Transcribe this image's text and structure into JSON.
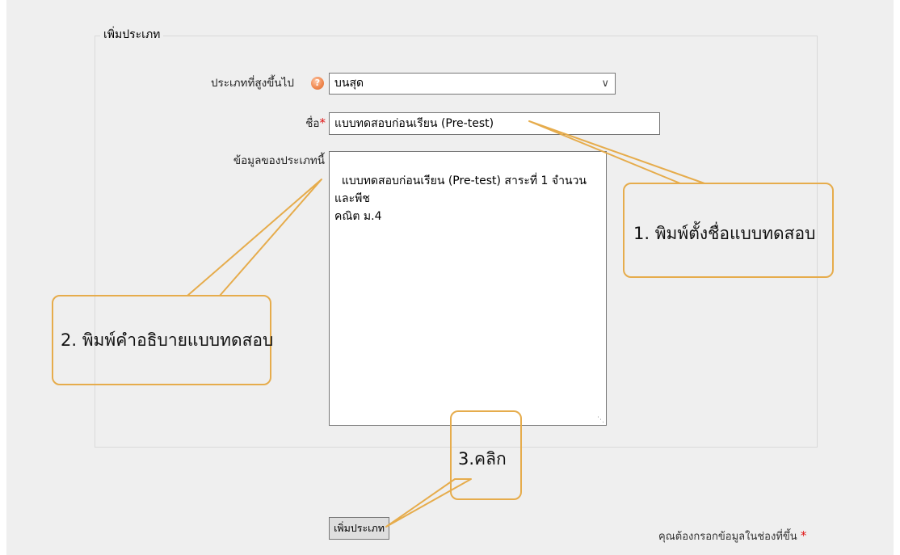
{
  "form": {
    "legend": "เพิ่มประเภท",
    "parent_label": "ประเภทที่สูงขึ้นไป",
    "help_icon_glyph": "?",
    "parent_value": "บนสุด",
    "name_label": "ชื่อ",
    "required_mark": "*",
    "name_value": "แบบทดสอบก่อนเรียน (Pre-test)",
    "info_label": "ข้อมูลของประเภทนี้",
    "info_value": "แบบทดสอบก่อนเรียน (Pre-test) สาระที่ 1 จำนวนและพีช\nคณิต ม.4",
    "submit_label": "เพิ่มประเภท",
    "required_note": "คุณต้องกรอกข้อมูลในช่องที่ขึ้น"
  },
  "callouts": {
    "step1": "1. พิมพ์ตั้งชื่อแบบทดสอบ",
    "step2": "2. พิมพ์คำอธิบายแบบทดสอบ",
    "step3": "3.คลิก"
  },
  "colors": {
    "callout_border": "#e6ac4c",
    "required": "#e01010",
    "help_icon": "#f08a52",
    "page_background": "#efefef"
  },
  "icons": {
    "help": "help-icon",
    "dropdown": "chevron-down-icon",
    "resize": "resize-grip-icon"
  }
}
